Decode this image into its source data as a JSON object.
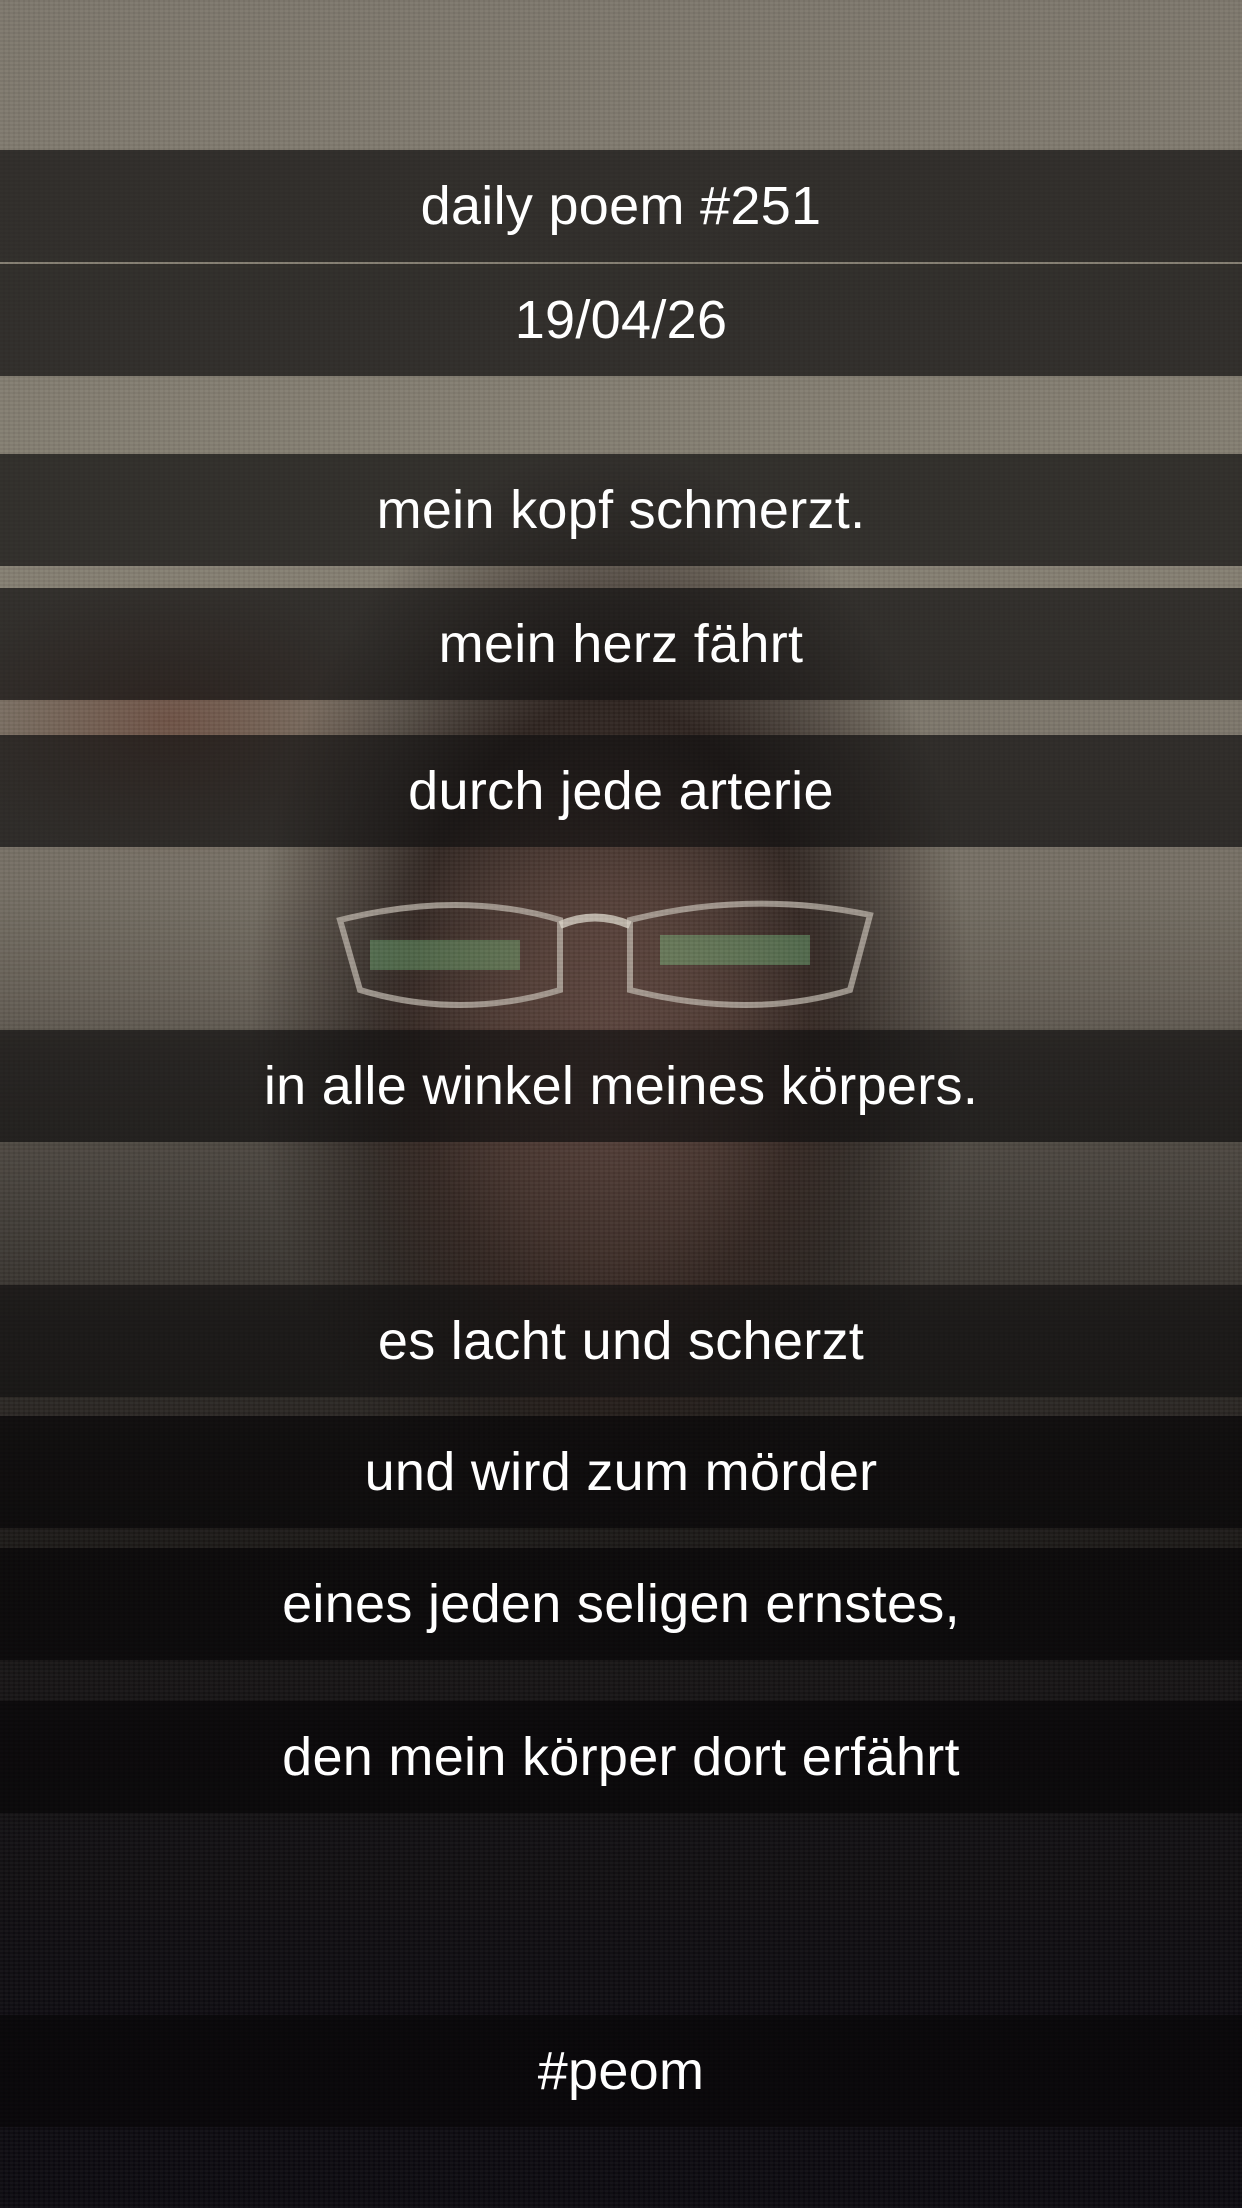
{
  "poem": {
    "title": "daily poem #251",
    "date": "19/04/26",
    "lines": [
      "mein kopf schmerzt.",
      "mein herz fährt",
      "durch jede arterie",
      "in alle winkel meines körpers.",
      "es lacht und scherzt",
      "und wird zum mörder",
      "eines jeden seligen ernstes,",
      "den mein körper dort erfährt"
    ],
    "hashtag": "#peom"
  },
  "colors": {
    "text": "#ffffff",
    "band": "#141212"
  }
}
